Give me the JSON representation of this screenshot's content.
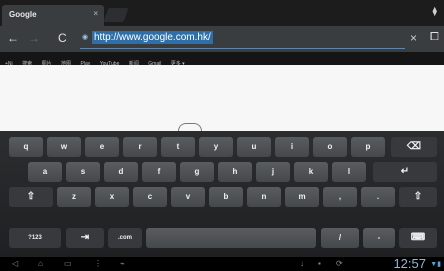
{
  "tab": {
    "title": "Google",
    "close": "×"
  },
  "toolbar": {
    "back": "←",
    "forward": "→",
    "reload": "C",
    "url": "http://www.google.com.hk/",
    "clear": "×",
    "bookmark": "⧠",
    "tab_menu": "⧫"
  },
  "google_links": [
    "+Ni",
    "搜索",
    "图片",
    "地图",
    "Play",
    "YouTube",
    "新闻",
    "Gmail",
    "更多 ▾"
  ],
  "keyboard": {
    "row1": [
      "q",
      "w",
      "e",
      "r",
      "t",
      "y",
      "u",
      "i",
      "o",
      "p",
      "⌫"
    ],
    "row2": [
      "a",
      "s",
      "d",
      "f",
      "g",
      "h",
      "j",
      "k",
      "l",
      "↵"
    ],
    "row3": [
      "⇧",
      "z",
      "x",
      "c",
      "v",
      "b",
      "n",
      "m",
      ",",
      ".",
      "⇧"
    ],
    "row4": [
      "?123",
      "⇥",
      ".com",
      "",
      "/",
      "-",
      "⌨"
    ]
  },
  "system_bar": {
    "time": "12:57",
    "icons": [
      "back-icon",
      "home-icon",
      "recent-apps-icon",
      "menu-icon",
      "usb-icon",
      "download-icon",
      "wifi-icon",
      "battery-icon"
    ]
  },
  "colors": {
    "url_highlight": "#2f6fa8",
    "clock": "#8eb8d9",
    "key": "#505356"
  }
}
